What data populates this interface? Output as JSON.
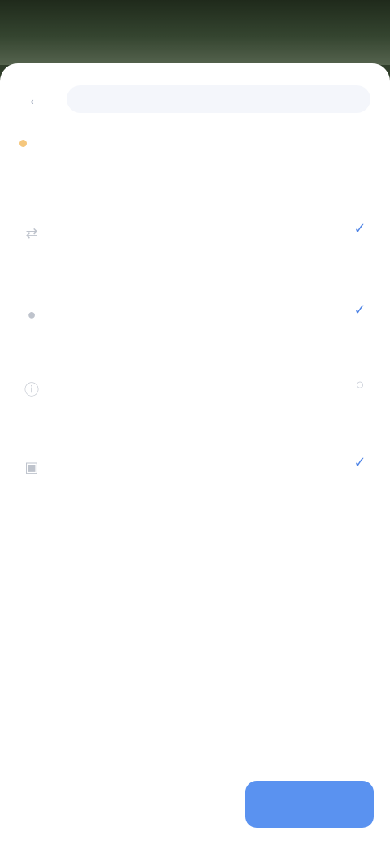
{
  "statusbar": {
    "time": "",
    "system": ""
  },
  "topbar": {
    "back_icon": "back-arrow-icon",
    "route_text": ""
  },
  "step": {
    "label": "",
    "dot_color": "#f5c77d"
  },
  "section": {
    "title": ""
  },
  "items": [
    {
      "icon": "route-icon",
      "title": "",
      "subtitle": "",
      "status_icon": "check-icon",
      "status_color": "#4f84e6"
    },
    {
      "icon": "location-icon",
      "title": "",
      "subtitle": "",
      "status_icon": "check-icon",
      "status_color": "#4f84e6"
    },
    {
      "icon": "info-icon",
      "title": "",
      "subtitle": "",
      "status_icon": "radio-icon",
      "status_color": "#c7ccd6"
    },
    {
      "icon": "calendar-icon",
      "title": "",
      "subtitle": "",
      "status_icon": "check-icon",
      "status_color": "#4f84e6",
      "note": ""
    }
  ],
  "footer": {
    "left_label": "",
    "middle_label": "",
    "primary_label": "",
    "primary_color": "#5a92f0"
  }
}
